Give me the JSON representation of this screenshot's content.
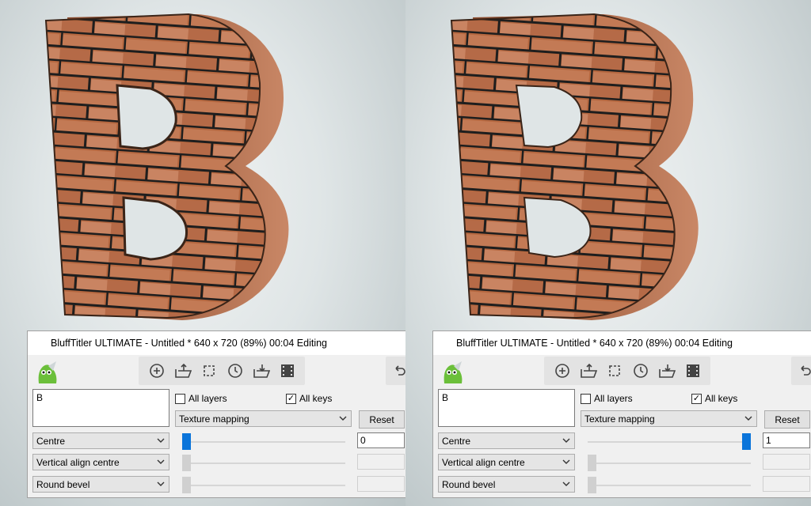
{
  "panels": [
    {
      "id": "left",
      "window": {
        "title": "BluffTitler ULTIMATE  - Untitled * 640 x 720 (89%) 00:04 Editing",
        "text_content": "B",
        "all_layers": {
          "label": "All layers",
          "checked": false
        },
        "all_keys": {
          "label": "All keys",
          "checked": true
        },
        "property_select": "Texture mapping",
        "reset_label": "Reset",
        "selects": [
          "Centre",
          "Vertical align centre",
          "Round bevel"
        ],
        "slider_value": "0",
        "slider_fraction": 0.0
      }
    },
    {
      "id": "right",
      "window": {
        "title": "BluffTitler ULTIMATE  - Untitled * 640 x 720 (89%) 00:04 Editing",
        "text_content": "B",
        "all_layers": {
          "label": "All layers",
          "checked": false
        },
        "all_keys": {
          "label": "All keys",
          "checked": true
        },
        "property_select": "Texture mapping",
        "reset_label": "Reset",
        "selects": [
          "Centre",
          "Vertical align centre",
          "Round bevel"
        ],
        "slider_value": "1",
        "slider_fraction": 1.0
      }
    }
  ],
  "toolbar_icons": [
    "add-icon",
    "open-icon",
    "frame-icon",
    "clock-icon",
    "import-icon",
    "film-icon"
  ],
  "colors": {
    "accent": "#0a74da",
    "brick": "#b86a45",
    "mortar": "#2a2a2a"
  }
}
